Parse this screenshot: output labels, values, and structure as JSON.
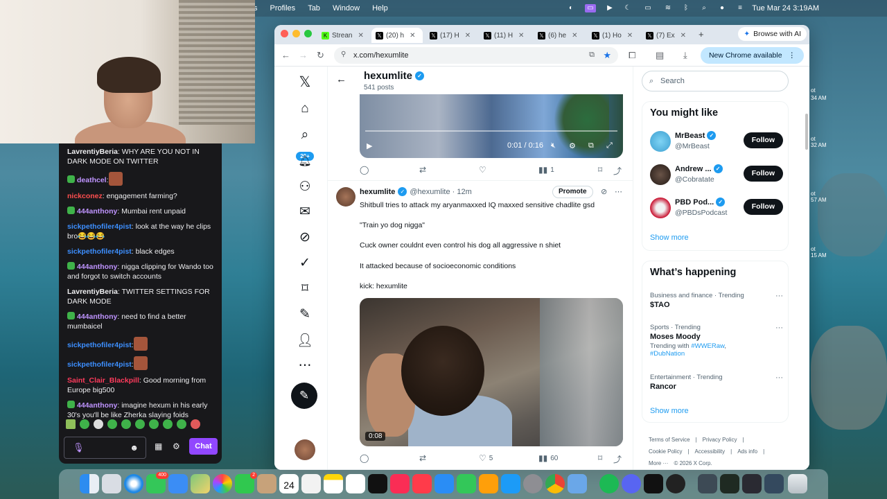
{
  "menubar": {
    "items": [
      "s",
      "Profiles",
      "Tab",
      "Window",
      "Help"
    ],
    "clock": "Tue Mar 24  3:19AM"
  },
  "chat": {
    "messages": [
      {
        "user": "LavrentiyBeria",
        "color": "#efeff1",
        "text": ": WHY ARE YOU NOT IN DARK MODE ON TWITTER"
      },
      {
        "user": "deathcel",
        "color": "#bf94ff",
        "text": ":"
      },
      {
        "user": "nickconez",
        "color": "#ff4f4f",
        "text": ": engagement farming?"
      },
      {
        "user": "444anthony",
        "color": "#bf94ff",
        "text": ": Mumbai rent unpaid"
      },
      {
        "user": "sickpethofiler4pist",
        "color": "#3d8fff",
        "text": ": look at the way he clips bro😂😂😂"
      },
      {
        "user": "sickpethofiler4pist",
        "color": "#3d8fff",
        "text": ": black edges"
      },
      {
        "user": "444anthony",
        "color": "#bf94ff",
        "text": ": nigga clipping for Wando too and forgot to switch accounts"
      },
      {
        "user": "LavrentiyBeria",
        "color": "#efeff1",
        "text": ": TWITTER SETTINGS FOR DARK MODE"
      },
      {
        "user": "444anthony",
        "color": "#bf94ff",
        "text": ": need to find a better mumbaicel"
      },
      {
        "user": "sickpethofiler4pist",
        "color": "#3d8fff",
        "text": ":"
      },
      {
        "user": "sickpethofiler4pist",
        "color": "#3d8fff",
        "text": ":"
      },
      {
        "user": "Saint_Clair_Blackpill",
        "color": "#ff3b5c",
        "text": ": Good morning from Europe big500"
      },
      {
        "user": "444anthony",
        "color": "#bf94ff",
        "text": ": imagine hexum in his early 30's you'll be like Zherka slaying foids"
      }
    ],
    "chat_button": "Chat"
  },
  "browser": {
    "tabs": [
      {
        "label": "Strean",
        "active": false
      },
      {
        "label": "(20) h",
        "active": true
      },
      {
        "label": "(17) H",
        "active": false
      },
      {
        "label": "(11) H",
        "active": false
      },
      {
        "label": "(6) he",
        "active": false
      },
      {
        "label": "(1) Ho",
        "active": false
      },
      {
        "label": "(7) Ex",
        "active": false
      }
    ],
    "ai_button": "Browse with AI",
    "url": "x.com/hexumlite",
    "new_chrome": "New Chrome available"
  },
  "profile": {
    "name": "hexumlite",
    "posts": "541 posts"
  },
  "video1": {
    "time": "0:01 / 0:16",
    "stats": {
      "views": "1"
    }
  },
  "tweet": {
    "name": "hexumlite",
    "handle": "@hexumlite · 12m",
    "promote": "Promote",
    "lines": [
      "Shitbull tries to attack my aryanmaxxed IQ maxxed sensitive chadlite gsd",
      "\"Train yo dog nigga\"",
      "Cuck owner couldnt even control his dog all aggressive n shiet",
      "It attacked because of socioeconomic conditions",
      "kick: hexumlite"
    ],
    "video_time": "0:08",
    "likes": "5",
    "views": "60"
  },
  "sidebar": {
    "search_placeholder": "Search",
    "might_like_title": "You might like",
    "suggestions": [
      {
        "name": "MrBeast",
        "handle": "@MrBeast",
        "follow": "Follow"
      },
      {
        "name": "Andrew ...",
        "handle": "@Cobratate",
        "follow": "Follow"
      },
      {
        "name": "PBD Pod...",
        "handle": "@PBDsPodcast",
        "follow": "Follow"
      }
    ],
    "show_more": "Show more",
    "happening_title": "What’s happening",
    "trends": [
      {
        "category": "Business and finance · Trending",
        "title": "$TAO",
        "sub_prefix": "",
        "tags": []
      },
      {
        "category": "Sports · Trending",
        "title": "Moses Moody",
        "sub_prefix": "Trending with ",
        "tags": [
          "#WWERaw",
          "#DubNation"
        ]
      },
      {
        "category": "Entertainment · Trending",
        "title": "Rancor",
        "sub_prefix": "",
        "tags": []
      }
    ],
    "trend_more": "···",
    "show_more_2": "Show more",
    "footer": {
      "line1": [
        "Terms of Service",
        "|",
        "Privacy Policy",
        "|"
      ],
      "line2": [
        "Cookie Policy",
        "|",
        "Accessibility",
        "|",
        "Ads info",
        "|"
      ],
      "line3": [
        "More ···",
        "© 2026 X Corp."
      ]
    }
  },
  "nav": {
    "notif_badge": "20+"
  },
  "dock": {
    "mail_badge": "400",
    "facetime_badge": "2",
    "calendar_day": "24"
  },
  "desktop_text": [
    "ot",
    "34 AM",
    "ot",
    "32 AM",
    "ot",
    "57 AM",
    "ot",
    "15 AM"
  ]
}
